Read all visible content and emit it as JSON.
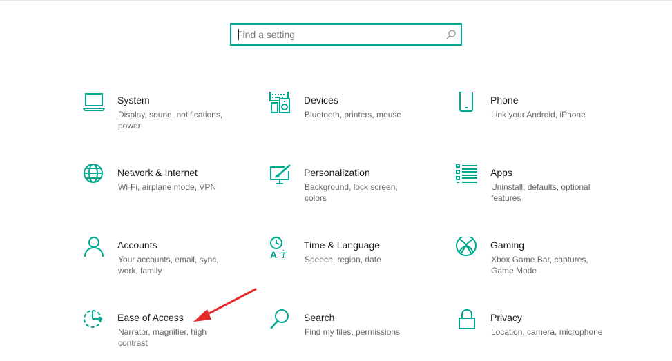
{
  "search": {
    "placeholder": "Find a setting"
  },
  "accent_color": "#00a88f",
  "annotation_color": "#e32b2b",
  "tiles": [
    {
      "title": "System",
      "desc": "Display, sound, notifications, power",
      "icon": "laptop-icon"
    },
    {
      "title": "Devices",
      "desc": "Bluetooth, printers, mouse",
      "icon": "keyboard-speaker-icon"
    },
    {
      "title": "Phone",
      "desc": "Link your Android, iPhone",
      "icon": "phone-icon"
    },
    {
      "title": "Network & Internet",
      "desc": "Wi-Fi, airplane mode, VPN",
      "icon": "globe-icon"
    },
    {
      "title": "Personalization",
      "desc": "Background, lock screen, colors",
      "icon": "paintbrush-icon"
    },
    {
      "title": "Apps",
      "desc": "Uninstall, defaults, optional features",
      "icon": "apps-list-icon"
    },
    {
      "title": "Accounts",
      "desc": "Your accounts, email, sync, work, family",
      "icon": "person-icon"
    },
    {
      "title": "Time & Language",
      "desc": "Speech, region, date",
      "icon": "time-language-icon"
    },
    {
      "title": "Gaming",
      "desc": "Xbox Game Bar, captures, Game Mode",
      "icon": "xbox-icon"
    },
    {
      "title": "Ease of Access",
      "desc": "Narrator, magnifier, high contrast",
      "icon": "ease-of-access-icon"
    },
    {
      "title": "Search",
      "desc": "Find my files, permissions",
      "icon": "magnifier-icon"
    },
    {
      "title": "Privacy",
      "desc": "Location, camera, microphone",
      "icon": "lock-icon"
    }
  ]
}
